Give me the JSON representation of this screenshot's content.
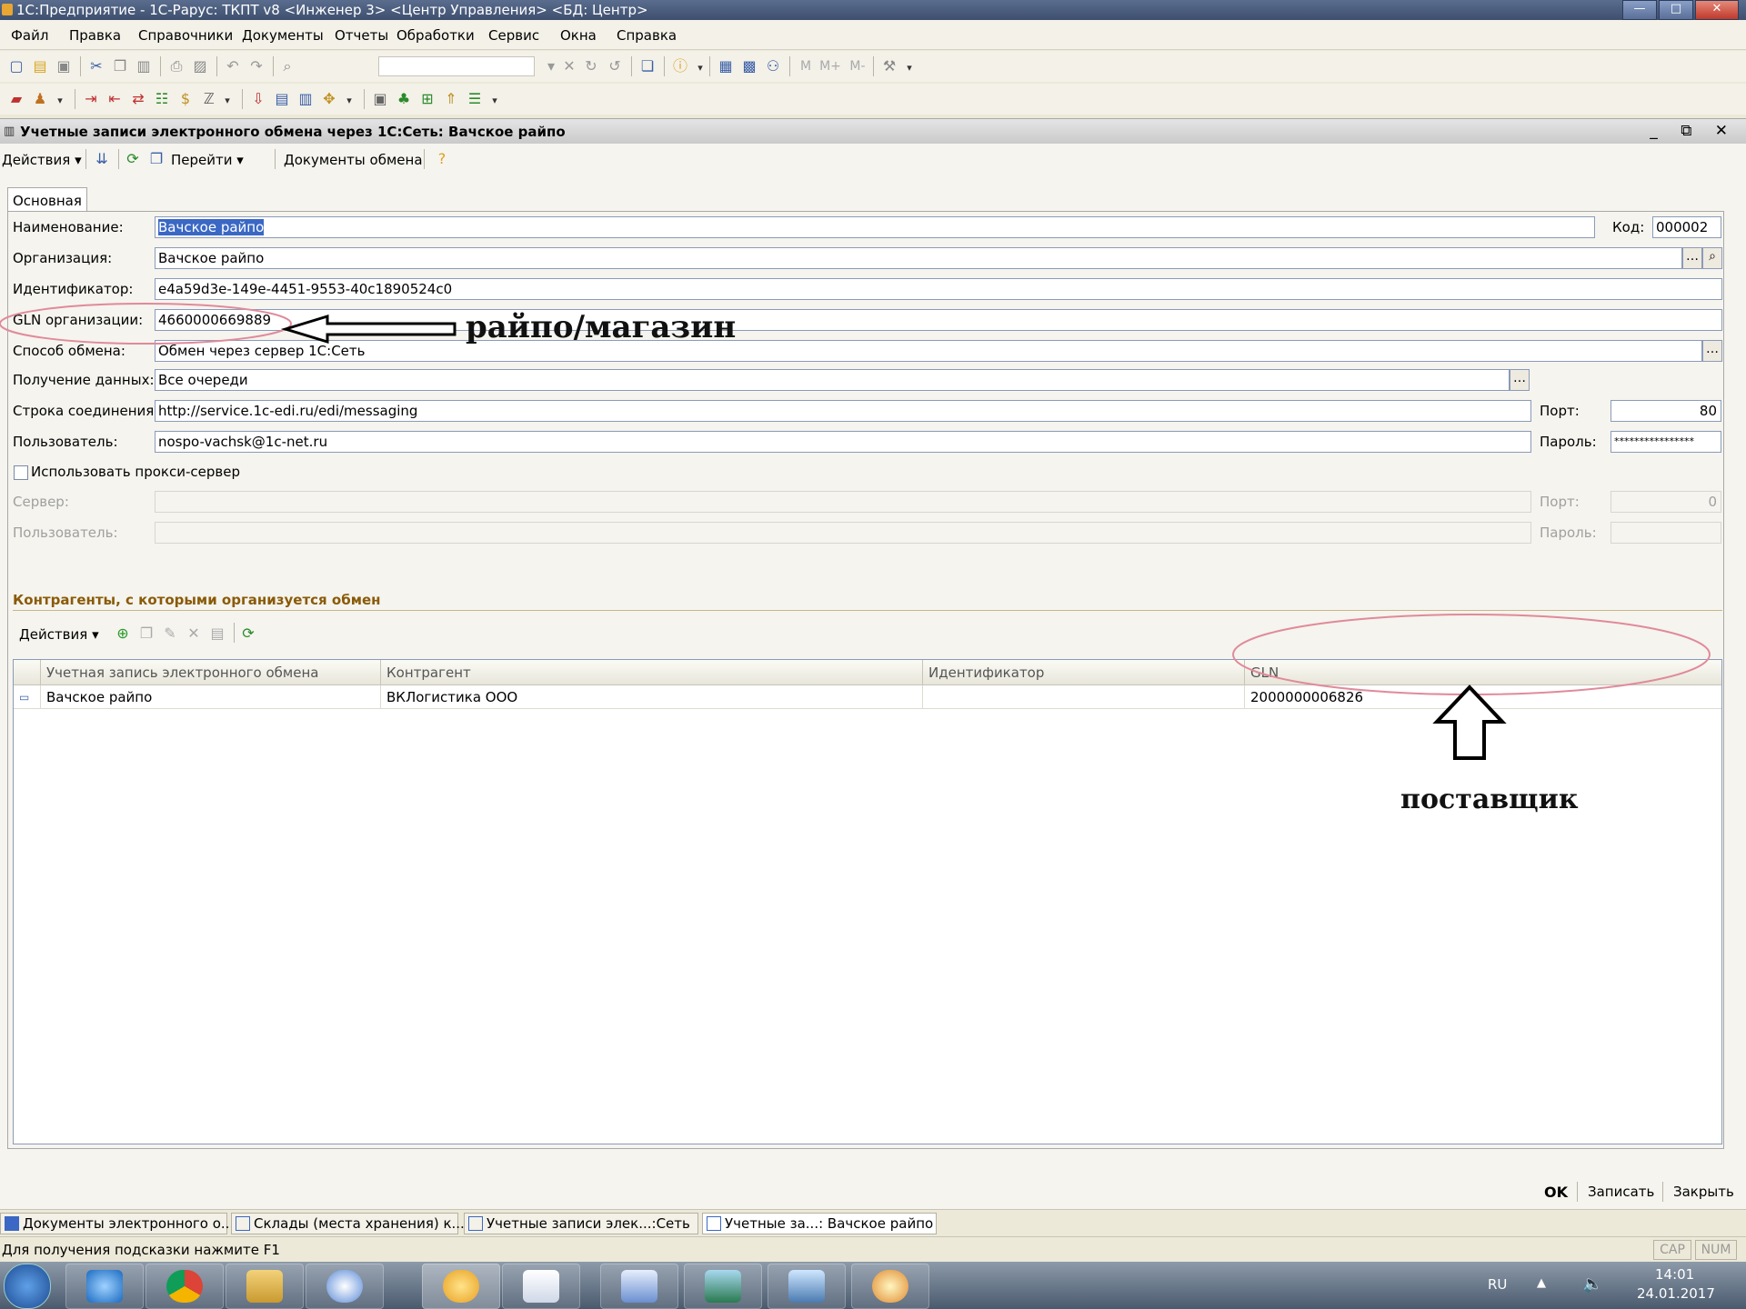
{
  "window": {
    "title": "1С:Предприятие - 1С-Рарус: ТКПТ v8 <Инженер 3> <Центр Управления> <БД: Центр>"
  },
  "menu": [
    "Файл",
    "Правка",
    "Справочники",
    "Документы",
    "Отчеты",
    "Обработки",
    "Сервис",
    "Окна",
    "Справка"
  ],
  "toolbar_memory": {
    "m": "M",
    "mplus": "M+",
    "mminus": "M-"
  },
  "document": {
    "title": "Учетные записи электронного обмена через 1С:Сеть: Вачское райпо",
    "toolbar": {
      "actions": "Действия",
      "goto": "Перейти",
      "exchange_docs": "Документы обмена"
    },
    "tab": "Основная",
    "fields": {
      "name_label": "Наименование:",
      "name_value": "Вачское райпо",
      "code_label": "Код:",
      "code_value": "000002",
      "org_label": "Организация:",
      "org_value": "Вачское райпо",
      "id_label": "Идентификатор:",
      "id_value": "e4a59d3e-149e-4451-9553-40c1890524c0",
      "gln_label": "GLN организации:",
      "gln_value": "4660000669889",
      "method_label": "Способ обмена:",
      "method_value": "Обмен через сервер 1С:Сеть",
      "receive_label": "Получение данных:",
      "receive_value": "Все очереди",
      "conn_label": "Строка соединения:",
      "conn_value": "http://service.1c-edi.ru/edi/messaging",
      "port_label": "Порт:",
      "port_value": "80",
      "user_label": "Пользователь:",
      "user_value": "nospo-vachsk@1c-net.ru",
      "password_label": "Пароль:",
      "password_value": "****************",
      "proxy_label": "Использовать прокси-сервер",
      "server_label": "Сервер:",
      "proxy_port_label": "Порт:",
      "proxy_port_value": "0",
      "proxy_user_label": "Пользователь:",
      "proxy_password_label": "Пароль:"
    },
    "section_title": "Контрагенты, с которыми организуется обмен",
    "table_toolbar": {
      "actions": "Действия"
    },
    "table": {
      "columns": [
        "Учетная запись электронного обмена",
        "Контрагент",
        "Идентификатор",
        "GLN"
      ],
      "rows": [
        {
          "account": "Вачское райпо",
          "counterparty": "ВКЛогистика ООО",
          "identifier": "",
          "gln": "2000000006826"
        }
      ]
    },
    "buttons": {
      "ok": "OK",
      "save": "Записать",
      "close": "Закрыть"
    }
  },
  "annotations": {
    "org_note": "райпо/магазин",
    "supplier_note": "поставщик"
  },
  "window_tabs": [
    "Документы электронного о...",
    "Склады (места хранения) к...",
    "Учетные записи элек...:Сеть",
    "Учетные за...: Вачское райпо"
  ],
  "status": {
    "hint": "Для получения подсказки нажмите F1",
    "cap": "CAP",
    "num": "NUM"
  },
  "taskbar": {
    "lang": "RU",
    "time": "14:01",
    "date": "24.01.2017"
  },
  "colors": {
    "selection": "#3a68c4",
    "section_title": "#8a5a08",
    "annotation_circle": "#e08a9a"
  }
}
